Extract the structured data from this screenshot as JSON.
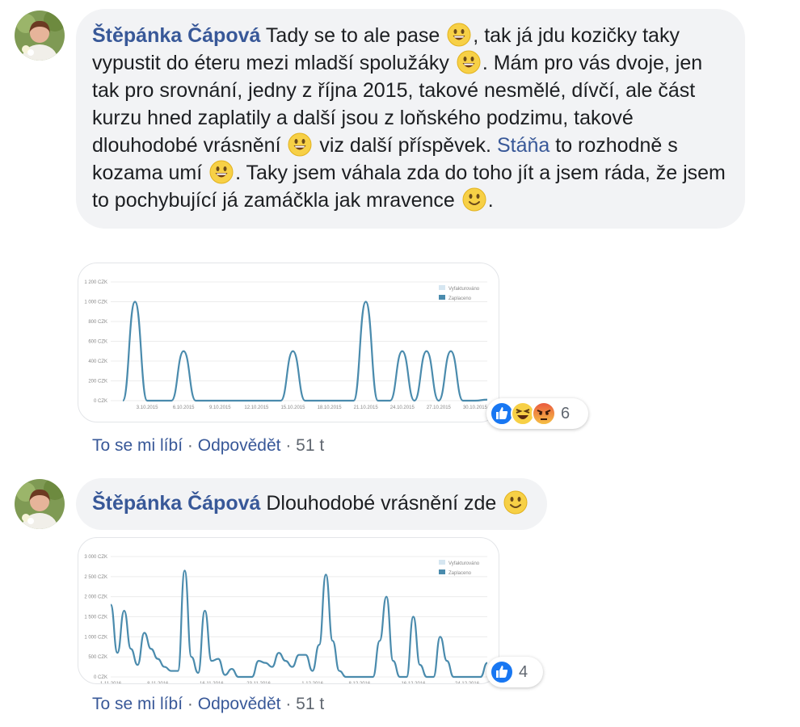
{
  "comments": [
    {
      "author": "Štěpánka Čápová",
      "text_parts": [
        {
          "type": "text",
          "value": "Tady se to ale pase "
        },
        {
          "type": "emoji",
          "name": "grinning-emoji"
        },
        {
          "type": "text",
          "value": ", tak já jdu kozičky taky vypustit do éteru mezi mladší spolužáky "
        },
        {
          "type": "emoji",
          "name": "grinning-emoji"
        },
        {
          "type": "text",
          "value": ". Mám pro vás dvoje, jen tak pro srovnání, jedny z října 2015, takové nesmělé, dívčí, ale část kurzu hned zaplatily a další jsou z loňského podzimu, takové dlouhodobé vrásnění "
        },
        {
          "type": "emoji",
          "name": "grinning-emoji"
        },
        {
          "type": "text",
          "value": " viz další příspěvek. "
        },
        {
          "type": "mention",
          "value": "Stáňa"
        },
        {
          "type": "text",
          "value": " to rozhodně s kozama umí "
        },
        {
          "type": "emoji",
          "name": "grinning-emoji"
        },
        {
          "type": "text",
          "value": ". Taky jsem váhala zda do toho jít a jsem ráda, že jsem to pochybující já zamáčkla jak mravence "
        },
        {
          "type": "emoji",
          "name": "smiling-emoji"
        },
        {
          "type": "text",
          "value": "."
        }
      ],
      "actions": {
        "like": "To se mi líbí",
        "separator": "·",
        "reply": "Odpovědět",
        "age": "51 t"
      },
      "reactions": {
        "icons": [
          "like-icon",
          "haha-icon",
          "angry-icon"
        ],
        "count": "6"
      }
    },
    {
      "author": "Štěpánka Čápová",
      "text_parts": [
        {
          "type": "text",
          "value": "Dlouhodobé vrásnění zde "
        },
        {
          "type": "emoji",
          "name": "smiling-emoji"
        }
      ],
      "actions": {
        "like": "To se mi líbí",
        "separator": "·",
        "reply": "Odpovědět",
        "age": "51 t"
      },
      "reactions": {
        "icons": [
          "like-icon"
        ],
        "count": "4"
      }
    }
  ],
  "colors": {
    "link": "#385898",
    "bubble": "#f2f3f5",
    "line": "#4a8bad",
    "legend_light": "#d6e6f1",
    "legend_dark": "#4a8bad"
  },
  "chart_data": [
    {
      "type": "line",
      "ylim": [
        0,
        1200
      ],
      "yticks": [
        "0 CZK",
        "200 CZK",
        "400 CZK",
        "600 CZK",
        "800 CZK",
        "1 000 CZK",
        "1 200 CZK"
      ],
      "ytick_values": [
        0,
        200,
        400,
        600,
        800,
        1000,
        1200
      ],
      "xlim": [
        0,
        31
      ],
      "xticks": [
        "3.10.2015",
        "6.10.2015",
        "9.10.2015",
        "12.10.2015",
        "15.10.2015",
        "18.10.2015",
        "21.10.2015",
        "24.10.2015",
        "27.10.2015",
        "30.10.2015"
      ],
      "xtick_positions": [
        3,
        6,
        9,
        12,
        15,
        18,
        21,
        24,
        27,
        30
      ],
      "legend": [
        "Vyfakturováno",
        "Zaplaceno"
      ],
      "legend_position": "top-right",
      "series": [
        {
          "name": "Zaplaceno",
          "x": [
            1,
            2,
            3,
            4,
            5,
            6,
            7,
            8,
            9,
            10,
            11,
            12,
            13,
            14,
            15,
            16,
            17,
            18,
            19,
            20,
            21,
            22,
            23,
            24,
            25,
            26,
            27,
            28,
            29,
            30,
            31
          ],
          "values": [
            0,
            1000,
            0,
            0,
            0,
            500,
            0,
            0,
            0,
            0,
            0,
            0,
            0,
            0,
            500,
            0,
            0,
            0,
            0,
            0,
            1000,
            0,
            0,
            500,
            0,
            500,
            0,
            500,
            0,
            0,
            10
          ]
        }
      ]
    },
    {
      "type": "line",
      "ylim": [
        0,
        3000
      ],
      "yticks": [
        "0 CZK",
        "500 CZK",
        "1 000 CZK",
        "1 500 CZK",
        "2 000 CZK",
        "2 500 CZK",
        "3 000 CZK"
      ],
      "ytick_values": [
        0,
        500,
        1000,
        1500,
        2000,
        2500,
        3000
      ],
      "xlim": [
        0,
        56
      ],
      "xticks": [
        "1.11.2016",
        "8.11.2016",
        "16.11.2016",
        "23.11.2016",
        "1.12.2016",
        "8.12.2016",
        "16.12.2016",
        "24.12.2016"
      ],
      "xtick_positions": [
        0,
        7,
        15,
        22,
        30,
        37,
        45,
        53
      ],
      "legend": [
        "Vyfakturováno",
        "Zaplaceno"
      ],
      "legend_position": "top-right",
      "series": [
        {
          "name": "Zaplaceno",
          "x": [
            0,
            1,
            2,
            3,
            4,
            5,
            6,
            7,
            8,
            9,
            10,
            11,
            12,
            13,
            14,
            15,
            16,
            17,
            18,
            19,
            20,
            21,
            22,
            23,
            24,
            25,
            26,
            27,
            28,
            29,
            30,
            31,
            32,
            33,
            34,
            35,
            36,
            37,
            38,
            39,
            40,
            41,
            42,
            43,
            44,
            45,
            46,
            47,
            48,
            49,
            50,
            51,
            52,
            53,
            54,
            55,
            56
          ],
          "values": [
            1800,
            600,
            1650,
            700,
            300,
            1100,
            700,
            450,
            250,
            150,
            150,
            2650,
            500,
            100,
            1650,
            400,
            450,
            50,
            200,
            0,
            0,
            0,
            400,
            350,
            250,
            600,
            400,
            250,
            550,
            550,
            150,
            800,
            2550,
            900,
            150,
            0,
            0,
            0,
            0,
            0,
            900,
            2000,
            400,
            0,
            0,
            1500,
            300,
            0,
            0,
            1000,
            400,
            0,
            0,
            0,
            0,
            0,
            350
          ]
        }
      ]
    }
  ]
}
